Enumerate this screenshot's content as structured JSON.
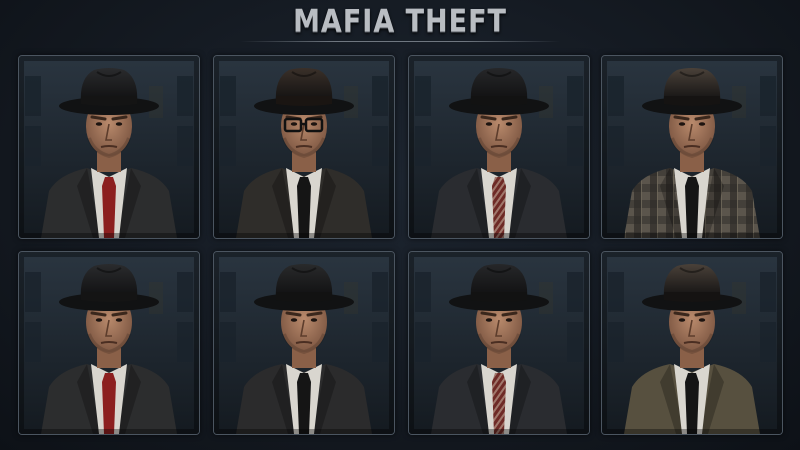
{
  "header": {
    "title": "MAFIA THEFT"
  },
  "palette": {
    "background": "#12171e",
    "card_border": "#4b5560",
    "title_color": "#b9bdc2"
  },
  "characters": [
    {
      "name": "mobster-1",
      "hat": "#2a2b2d",
      "band": "#141414",
      "coat": "#2c2d2e",
      "coat_style": "solid",
      "tie": "#8c1f1f",
      "tie_style": "solid",
      "glasses": false
    },
    {
      "name": "mobster-2",
      "hat": "#3a3029",
      "band": "#1a1512",
      "coat": "#2f2d2a",
      "coat_style": "solid",
      "tie": "#151515",
      "tie_style": "solid",
      "glasses": true
    },
    {
      "name": "mobster-3",
      "hat": "#262729",
      "band": "#121212",
      "coat": "#2a2c30",
      "coat_style": "solid",
      "tie": "#6e2a26",
      "tie_style": "striped",
      "glasses": false
    },
    {
      "name": "mobster-4",
      "hat": "#4a4139",
      "band": "#151312",
      "coat": "#5b554c",
      "coat_style": "plaid",
      "tie": "#151515",
      "tie_style": "solid",
      "glasses": false
    },
    {
      "name": "mobster-5",
      "hat": "#2a2b2d",
      "band": "#141414",
      "coat": "#2c2d2e",
      "coat_style": "solid",
      "tie": "#8c1f1f",
      "tie_style": "solid",
      "glasses": false
    },
    {
      "name": "mobster-6",
      "hat": "#292a2b",
      "band": "#121212",
      "coat": "#2b2b2c",
      "coat_style": "solid",
      "tie": "#151515",
      "tie_style": "solid",
      "glasses": false
    },
    {
      "name": "mobster-7",
      "hat": "#262729",
      "band": "#121212",
      "coat": "#2a2c30",
      "coat_style": "solid",
      "tie": "#6e2a26",
      "tie_style": "striped",
      "glasses": false
    },
    {
      "name": "mobster-8",
      "hat": "#4a4139",
      "band": "#151312",
      "coat": "#57503f",
      "coat_style": "solid",
      "tie": "#151515",
      "tie_style": "solid",
      "glasses": false
    }
  ]
}
